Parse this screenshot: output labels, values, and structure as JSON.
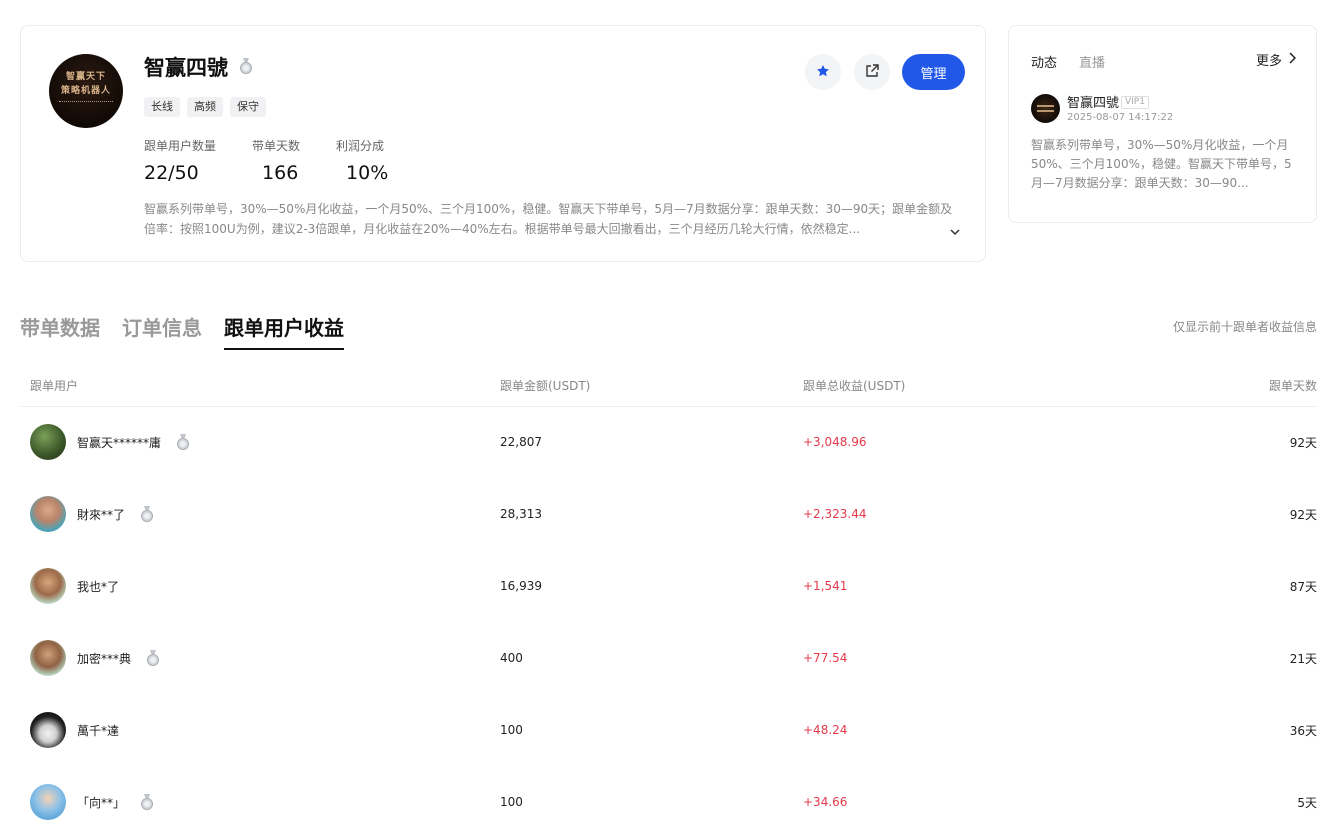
{
  "profile": {
    "name": "智赢四號",
    "avatar_text": [
      "智赢天下",
      "策略机器人"
    ],
    "tags": [
      "长线",
      "高频",
      "保守"
    ],
    "stats": [
      {
        "label": "跟单用户数量",
        "value": "22/50"
      },
      {
        "label": "带单天数",
        "value": "166"
      },
      {
        "label": "利润分成",
        "value": "10%"
      }
    ],
    "description": "智赢系列带单号，30%—50%月化收益，一个月50%、三个月100%，稳健。智赢天下带单号，5月—7月数据分享：跟单天数：30—90天；跟单金额及倍率：按照100U为例，建议2-3倍跟单，月化收益在20%—40%左右。根据带单号最大回撤看出，三个月经历几轮大行情，依然稳定...",
    "manage_label": "管理"
  },
  "feed": {
    "tabs": [
      "动态",
      "直播"
    ],
    "more_label": "更多",
    "post": {
      "author": "智赢四號",
      "badge": "VIP1",
      "time": "2025-08-07 14:17:22",
      "text": "智赢系列带单号，30%—50%月化收益，一个月50%、三个月100%，稳健。智赢天下带单号，5月—7月数据分享：跟单天数：30—90..."
    }
  },
  "tabs": [
    "带单数据",
    "订单信息",
    "跟单用户收益"
  ],
  "active_tab": 2,
  "notice": "仅显示前十跟单者收益信息",
  "table": {
    "headers": [
      "跟单用户",
      "跟单金额(USDT)",
      "跟单总收益(USDT)",
      "跟单天数"
    ],
    "rows": [
      {
        "user": "智赢天******庸",
        "medal": true,
        "amount": "22,807",
        "profit": "+3,048.96",
        "days": "92天"
      },
      {
        "user": "財來**了",
        "medal": true,
        "amount": "28,313",
        "profit": "+2,323.44",
        "days": "92天"
      },
      {
        "user": "我也*了",
        "medal": false,
        "amount": "16,939",
        "profit": "+1,541",
        "days": "87天"
      },
      {
        "user": "加密***典",
        "medal": true,
        "amount": "400",
        "profit": "+77.54",
        "days": "21天"
      },
      {
        "user": "萬千*達",
        "medal": false,
        "amount": "100",
        "profit": "+48.24",
        "days": "36天"
      },
      {
        "user": "「向**」",
        "medal": true,
        "amount": "100",
        "profit": "+34.66",
        "days": "5天"
      }
    ]
  },
  "colors": {
    "accent": "#2158e8",
    "profit": "#e53a4a"
  }
}
